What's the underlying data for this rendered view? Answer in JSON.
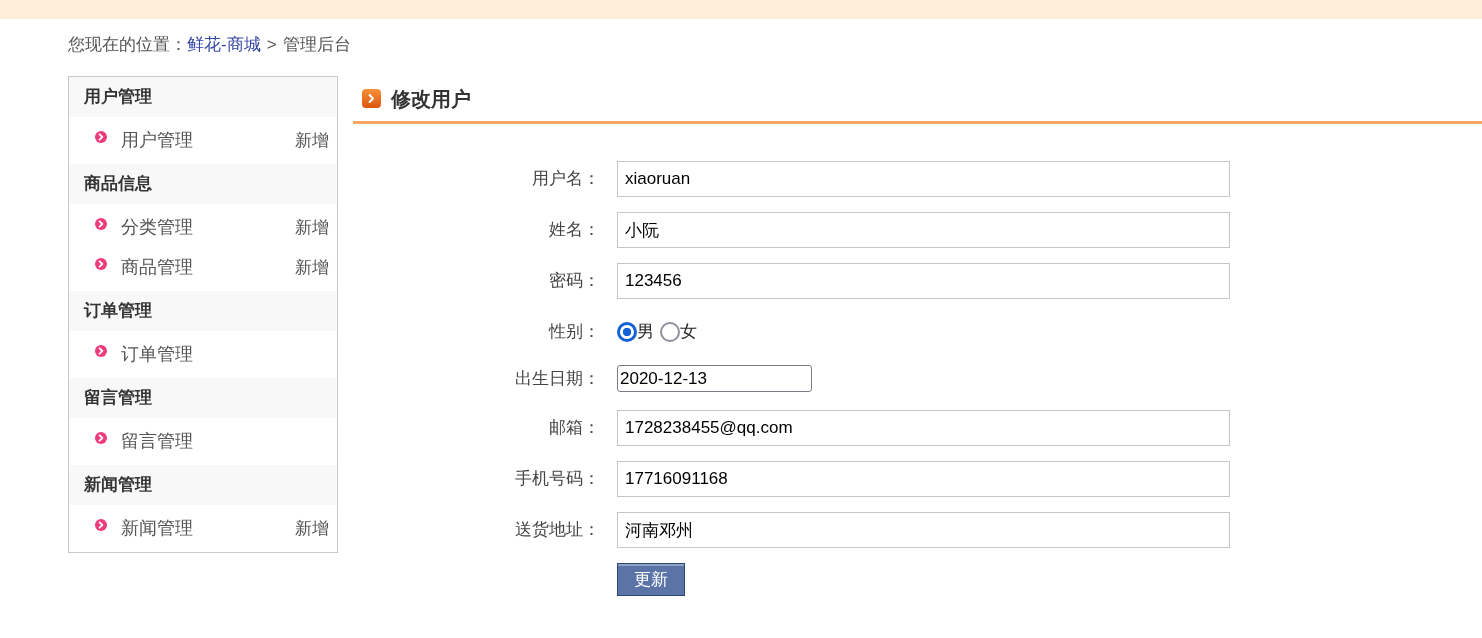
{
  "breadcrumb": {
    "prefix": "您现在的位置：",
    "items": [
      {
        "label": "鲜花-商城",
        "kind": "link"
      },
      {
        "label": "管理后台",
        "kind": "text"
      }
    ],
    "separator": ">"
  },
  "sidebar": {
    "groups": [
      {
        "title": "用户管理",
        "items": [
          {
            "label": "用户管理",
            "action": "新增"
          }
        ]
      },
      {
        "title": "商品信息",
        "items": [
          {
            "label": "分类管理",
            "action": "新增"
          },
          {
            "label": "商品管理",
            "action": "新增"
          }
        ]
      },
      {
        "title": "订单管理",
        "items": [
          {
            "label": "订单管理"
          }
        ]
      },
      {
        "title": "留言管理",
        "items": [
          {
            "label": "留言管理"
          }
        ]
      },
      {
        "title": "新闻管理",
        "items": [
          {
            "label": "新闻管理",
            "action": "新增"
          }
        ]
      }
    ]
  },
  "panel": {
    "title": "修改用户"
  },
  "form": {
    "fields": [
      {
        "kind": "text",
        "label": "用户名：",
        "value": "xiaoruan"
      },
      {
        "kind": "text",
        "label": "姓名：",
        "value": "小阮"
      },
      {
        "kind": "text",
        "label": "密码：",
        "value": "123456"
      },
      {
        "kind": "radio",
        "label": "性别：",
        "options": [
          {
            "label": "男",
            "selected": true
          },
          {
            "label": "女",
            "selected": false
          }
        ]
      },
      {
        "kind": "date",
        "label": "出生日期：",
        "value": "2020-12-13"
      },
      {
        "kind": "text",
        "label": "邮箱：",
        "value": "1728238455@qq.com"
      },
      {
        "kind": "text",
        "label": "手机号码：",
        "value": "17716091168"
      },
      {
        "kind": "text",
        "label": "送货地址：",
        "value": "河南邓州"
      }
    ],
    "submit": "更新"
  }
}
